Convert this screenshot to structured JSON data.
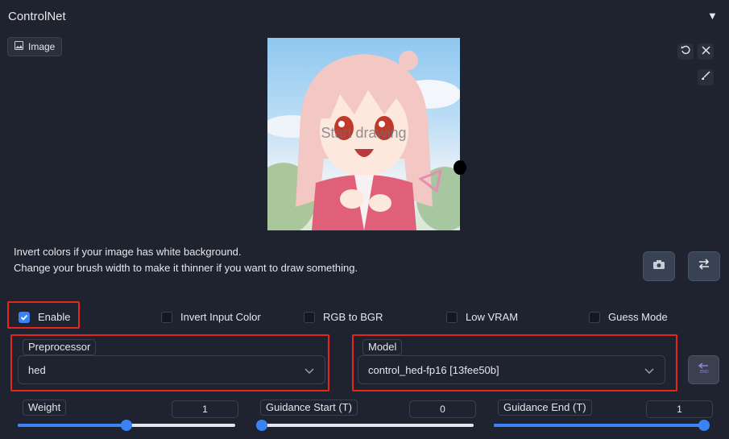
{
  "header": {
    "title": "ControlNet"
  },
  "image_tab": {
    "label": "Image"
  },
  "canvas": {
    "placeholder": "Start drawing"
  },
  "hints": {
    "line1": "Invert colors if your image has white background.",
    "line2": "Change your brush width to make it thinner if you want to draw something."
  },
  "options": {
    "enable": {
      "label": "Enable",
      "checked": true
    },
    "invert": {
      "label": "Invert Input Color",
      "checked": false
    },
    "rgb2bgr": {
      "label": "RGB to BGR",
      "checked": false
    },
    "lowvram": {
      "label": "Low VRAM",
      "checked": false
    },
    "guess": {
      "label": "Guess Mode",
      "checked": false
    }
  },
  "preprocessor": {
    "label": "Preprocessor",
    "value": "hed"
  },
  "model": {
    "label": "Model",
    "value": "control_hed-fp16 [13fee50b]"
  },
  "sliders": {
    "weight": {
      "label": "Weight",
      "value": "1",
      "fraction": 0.5
    },
    "guidance_start": {
      "label": "Guidance Start (T)",
      "value": "0",
      "fraction": 0.0
    },
    "guidance_end": {
      "label": "Guidance End (T)",
      "value": "1",
      "fraction": 1.0
    }
  },
  "colors": {
    "accent": "#3b82f6",
    "highlight": "#e5261b"
  }
}
